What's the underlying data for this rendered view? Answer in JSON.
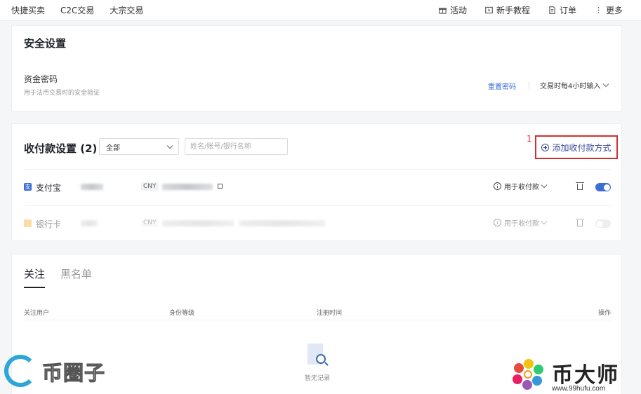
{
  "topnav": {
    "left_links": [
      "快捷买卖",
      "C2C交易",
      "大宗交易"
    ],
    "right_links": [
      {
        "label": "活动",
        "icon": "gift-icon"
      },
      {
        "label": "新手教程",
        "icon": "video-icon"
      },
      {
        "label": "订单",
        "icon": "document-icon"
      },
      {
        "label": "更多",
        "icon": "more-icon"
      }
    ]
  },
  "security": {
    "title": "安全设置",
    "fund_password_label": "资金密码",
    "fund_password_desc": "用于法币交易时的安全验证",
    "reset_label": "重置密码",
    "input_frequency": "交易时每4小时输入"
  },
  "payment": {
    "title": "收付款设置 (2)",
    "filter_value": "全部",
    "search_placeholder": "姓名/账号/银行名称",
    "annotation_number": "1",
    "add_button_label": "添加收付款方式",
    "methods": [
      {
        "name": "支付宝",
        "currency": "CNY",
        "usage": "用于收付款",
        "enabled": true,
        "icon_color": "#3c6fd6",
        "icon_text": "支"
      },
      {
        "name": "银行卡",
        "currency": "CNY",
        "usage": "用于收付款",
        "enabled": false,
        "icon_color": "#f0b838",
        "icon_text": ""
      }
    ]
  },
  "follow": {
    "tabs": [
      "关注",
      "黑名单"
    ],
    "active_tab": 0,
    "columns": [
      "关注用户",
      "身份等级",
      "注册时间",
      "操作"
    ],
    "empty_text": "暂无记录"
  },
  "watermarks": {
    "left_text": "币圈子",
    "right_title": "币大师",
    "right_url": "www.99hufu.com"
  },
  "colors": {
    "accent": "#3c6fd6",
    "link": "#3a6ad6",
    "annotation": "#d32f2f"
  }
}
